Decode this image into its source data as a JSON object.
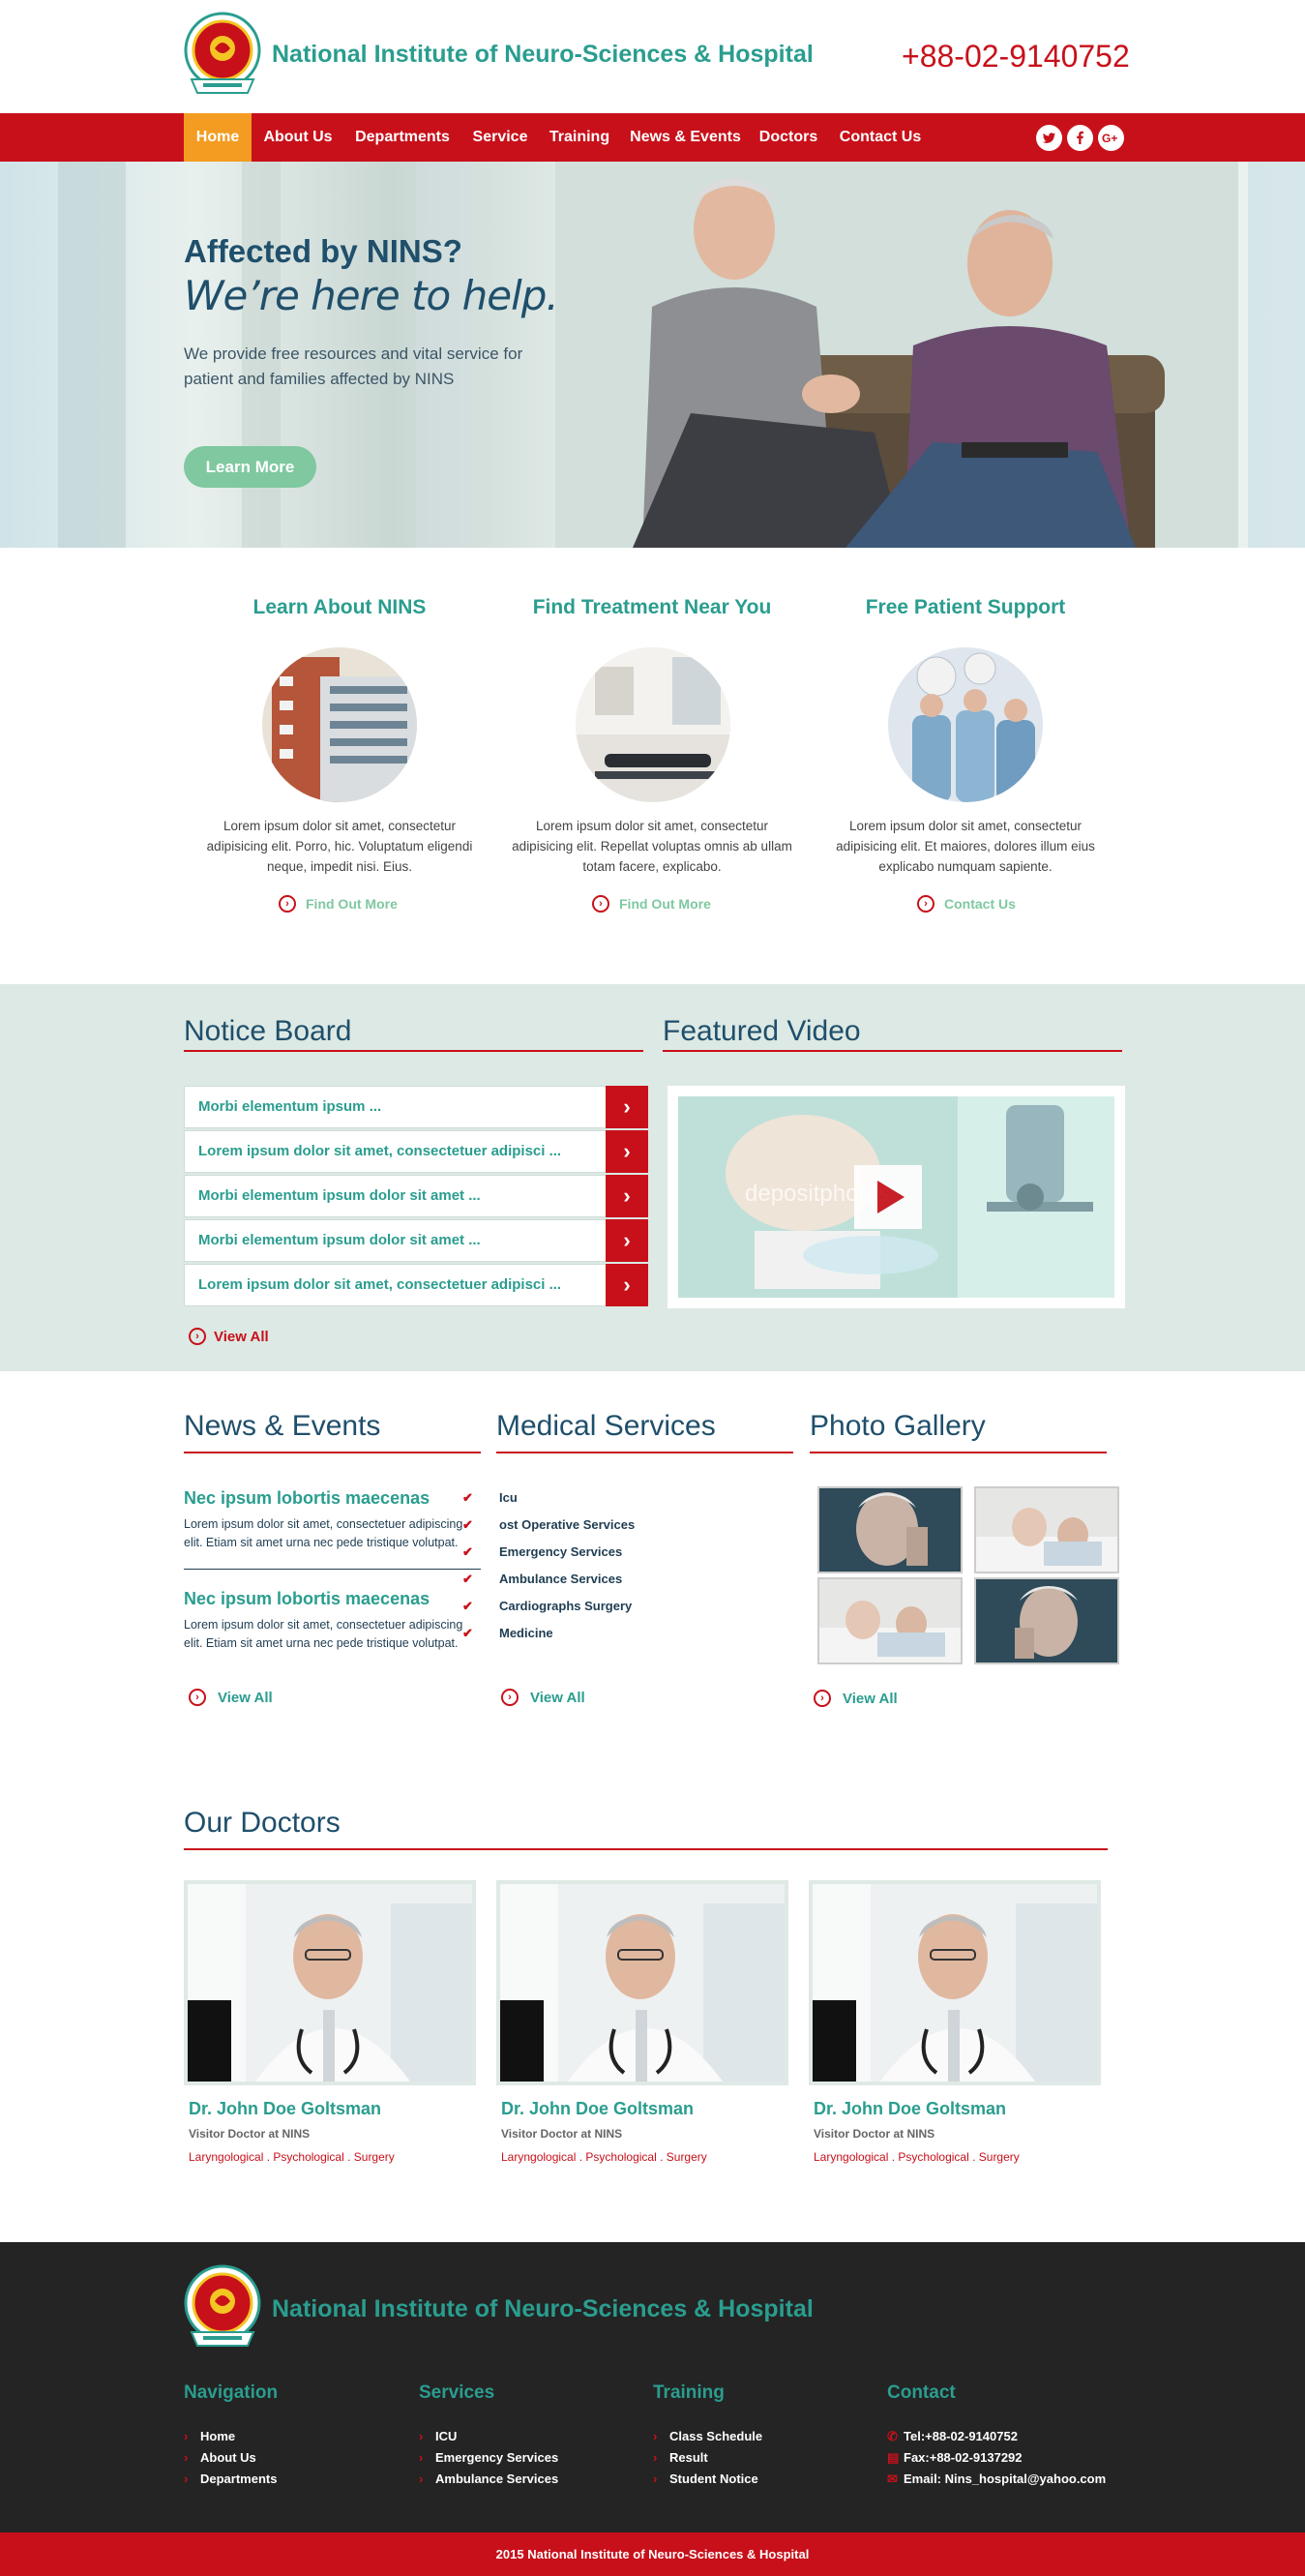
{
  "header": {
    "site_title": "National Institute of Neuro-Sciences & Hospital",
    "phone": "+88-02-9140752"
  },
  "nav": {
    "items": [
      "Home",
      "About Us",
      "Departments",
      "Service",
      "Training",
      "News & Events",
      "Doctors",
      "Contact Us"
    ],
    "active": "Home",
    "social": [
      "twitter",
      "facebook",
      "google-plus"
    ]
  },
  "hero": {
    "title_line1": "Affected by NINS?",
    "title_line2": "We’re here to help.",
    "text": "We provide free resources and vital service for patient and families affected by NINS",
    "button": "Learn More"
  },
  "features": [
    {
      "title": "Learn About NINS",
      "text": "Lorem ipsum dolor sit amet, consectetur adipisicing elit. Porro, hic. Voluptatum eligendi neque, impedit nisi. Eius.",
      "link": "Find Out More"
    },
    {
      "title": "Find Treatment Near You",
      "text": "Lorem ipsum dolor sit amet, consectetur adipisicing elit. Repellat voluptas omnis ab ullam totam facere, explicabo.",
      "link": "Find Out More"
    },
    {
      "title": "Free Patient Support",
      "text": "Lorem ipsum dolor sit amet, consectetur adipisicing elit. Et maiores, dolores illum eius explicabo numquam sapiente.",
      "link": "Contact Us"
    }
  ],
  "notice_board": {
    "title": "Notice Board",
    "items": [
      "Morbi elementum ipsum ...",
      "Lorem ipsum dolor sit amet, consectetuer adipisci ...",
      "Morbi elementum ipsum dolor sit amet ...",
      "Morbi elementum ipsum dolor sit amet ...",
      "Lorem ipsum dolor sit amet, consectetuer adipisci ..."
    ],
    "view_all": "View All"
  },
  "featured_video": {
    "title": "Featured Video",
    "watermark": "depositphotos"
  },
  "news": {
    "title": "News & Events",
    "items": [
      {
        "title": "Nec ipsum lobortis maecenas",
        "text": "Lorem ipsum dolor sit amet, consectetuer adipiscing elit. Etiam sit amet urna nec pede tristique volutpat."
      },
      {
        "title": "Nec ipsum lobortis maecenas",
        "text": "Lorem ipsum dolor sit amet, consectetuer adipiscing elit. Etiam sit amet urna nec pede tristique volutpat."
      }
    ],
    "view_all": "View All"
  },
  "medical_services": {
    "title": "Medical Services",
    "items": [
      "Icu",
      "ost Operative Services",
      "Emergency Services",
      "Ambulance Services",
      "Cardiographs Surgery",
      "Medicine"
    ],
    "view_all": "View All"
  },
  "gallery": {
    "title": "Photo Gallery",
    "view_all": "View All"
  },
  "doctors": {
    "title": "Our Doctors",
    "items": [
      {
        "name": "Dr. John Doe Goltsman",
        "role": "Visitor Doctor at NINS",
        "specialties": "Laryngological . Psychological . Surgery"
      },
      {
        "name": "Dr. John Doe Goltsman",
        "role": "Visitor Doctor at NINS",
        "specialties": "Laryngological . Psychological . Surgery"
      },
      {
        "name": "Dr. John Doe Goltsman",
        "role": "Visitor Doctor at NINS",
        "specialties": "Laryngological . Psychological . Surgery"
      }
    ]
  },
  "footer": {
    "site_title": "National Institute of Neuro-Sciences & Hospital",
    "navigation": {
      "title": "Navigation",
      "items": [
        "Home",
        "About Us",
        "Departments"
      ]
    },
    "services": {
      "title": "Services",
      "items": [
        "ICU",
        "Emergency Services",
        "Ambulance Services"
      ]
    },
    "training": {
      "title": "Training",
      "items": [
        "Class Schedule",
        "Result",
        "Student Notice"
      ]
    },
    "contact": {
      "title": "Contact",
      "items": [
        "Tel:+88-02-9140752",
        "Fax:+88-02-9137292",
        "Email: Nins_hospital@yahoo.com"
      ]
    },
    "copyright": "2015 National Institute of Neuro-Sciences & Hospital"
  },
  "colors": {
    "brand_red": "#c8101a",
    "teal": "#2a9d8f",
    "navy": "#1f4f6b",
    "active_orange": "#f39c21",
    "mint": "#7fc8a0",
    "band_bg": "#dde9e4",
    "footer_bg": "#242424"
  }
}
